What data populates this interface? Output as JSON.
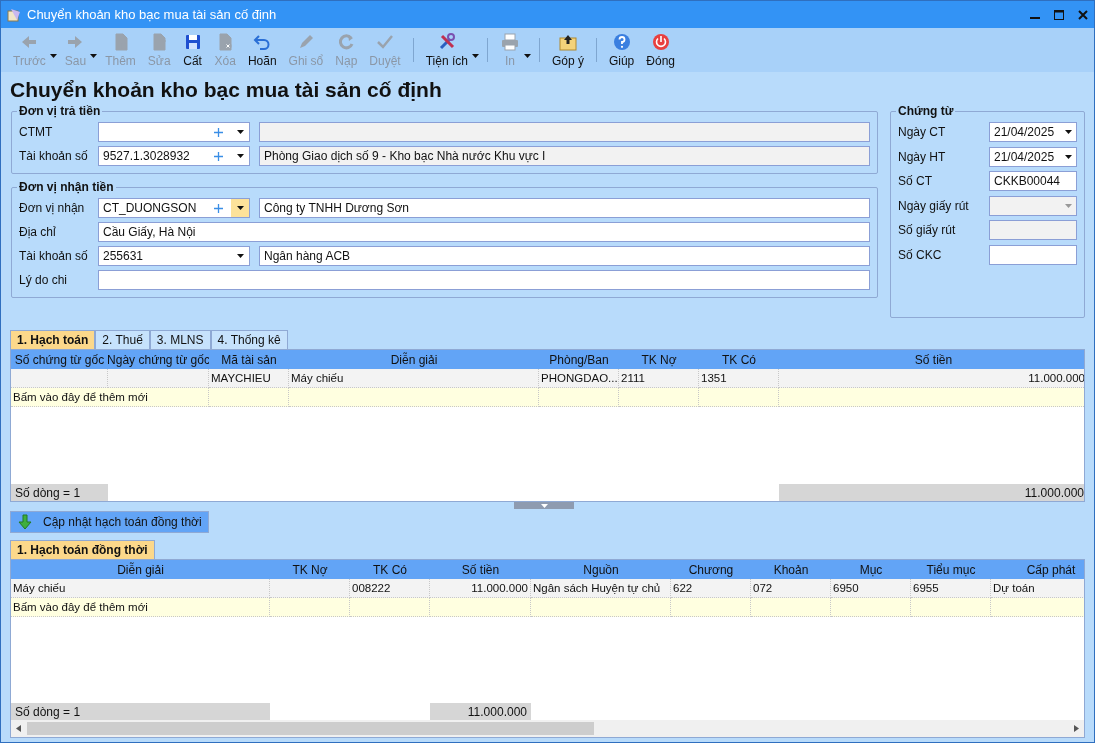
{
  "window": {
    "title": "Chuyển khoản kho bạc mua tài sản cố định"
  },
  "toolbar": [
    [
      {
        "label": "Trước",
        "disabled": true,
        "dropdown": true
      },
      {
        "label": "Sau",
        "disabled": true,
        "dropdown": true
      },
      {
        "label": "Thêm",
        "disabled": true,
        "dropdown": false
      },
      {
        "label": "Sửa",
        "disabled": true,
        "dropdown": false
      },
      {
        "label": "Cất",
        "disabled": false,
        "dropdown": false
      },
      {
        "label": "Xóa",
        "disabled": true,
        "dropdown": false
      },
      {
        "label": "Hoãn",
        "disabled": false,
        "dropdown": false
      },
      {
        "label": "Ghi sổ",
        "disabled": true,
        "dropdown": false
      },
      {
        "label": "Nạp",
        "disabled": true,
        "dropdown": false
      },
      {
        "label": "Duyệt",
        "disabled": true,
        "dropdown": false
      }
    ],
    [
      {
        "label": "Tiện ích",
        "disabled": false,
        "dropdown": true
      }
    ],
    [
      {
        "label": "In",
        "disabled": true,
        "dropdown": true
      }
    ],
    [
      {
        "label": "Góp ý",
        "disabled": false,
        "dropdown": false
      }
    ],
    [
      {
        "label": "Giúp",
        "disabled": false,
        "dropdown": false
      },
      {
        "label": "Đóng",
        "disabled": false,
        "dropdown": false
      }
    ]
  ],
  "heading": "Chuyển khoản kho bạc mua tài sản cố định",
  "payer": {
    "title": "Đơn vị trả tiền",
    "rows": [
      {
        "label": "CTMT",
        "fields": [
          {
            "kind": "combo",
            "plus": true,
            "highlighted": false
          },
          {
            "kind": "text",
            "disabled": true
          }
        ]
      },
      {
        "label": "Tài khoản số",
        "fields": [
          {
            "kind": "combo",
            "value": "9527.1.3028932",
            "plus": true,
            "highlighted": false
          },
          {
            "kind": "text",
            "value": "Phòng Giao dịch số 9 - Kho bạc Nhà nước Khu vực I",
            "disabled": true
          }
        ]
      }
    ]
  },
  "payee": {
    "title": "Đơn vị nhận tiền",
    "rows": [
      {
        "label": "Đơn vị nhận",
        "fields": [
          {
            "kind": "combo",
            "value": "CT_DUONGSON",
            "plus": true,
            "highlighted": true
          },
          {
            "kind": "text",
            "value": "Công ty TNHH Dương Sơn",
            "disabled": false
          }
        ]
      },
      {
        "label": "Địa chỉ",
        "fields": [
          {
            "kind": "text",
            "value": "Cầu Giấy, Hà Nội",
            "disabled": false
          }
        ]
      },
      {
        "label": "Tài khoản số",
        "fields": [
          {
            "kind": "combo",
            "value": "255631",
            "plus": false,
            "highlighted": false
          },
          {
            "kind": "text",
            "value": "Ngân hàng ACB",
            "disabled": false
          }
        ]
      },
      {
        "label": "Lý do chi",
        "fields": [
          {
            "kind": "text",
            "disabled": false
          }
        ]
      }
    ]
  },
  "voucher": {
    "title": "Chứng từ",
    "rows": [
      {
        "label": "Ngày CT",
        "kind": "date",
        "value": "21/04/2025",
        "disabled": false
      },
      {
        "label": "Ngày HT",
        "kind": "date",
        "value": "21/04/2025",
        "disabled": false
      },
      {
        "label": "Số CT",
        "kind": "text",
        "value": "CKKB00044",
        "disabled": false
      },
      {
        "label": "Ngày giấy rút",
        "kind": "date",
        "disabled": true
      },
      {
        "label": "Số giấy rút",
        "kind": "text",
        "disabled": true
      },
      {
        "label": "Số CKC",
        "kind": "text",
        "disabled": false
      }
    ]
  },
  "tabs": [
    {
      "label": "1. Hạch toán",
      "selected": true
    },
    {
      "label": "2. Thuế",
      "selected": false
    },
    {
      "label": "3. MLNS",
      "selected": false
    },
    {
      "label": "4. Thống kê",
      "selected": false
    }
  ],
  "entries_table": {
    "columns": [
      "Số chứng từ gốc",
      "Ngày chứng từ gốc",
      "Mã tài sản",
      "Diễn giải",
      "Phòng/Ban",
      "TK Nợ",
      "TK Có",
      "Số tiền"
    ],
    "rows": [
      [
        null,
        null,
        "MAYCHIEU",
        "Máy chiếu",
        "PHONGDAO...",
        "2111",
        "1351",
        "11.000.000"
      ]
    ],
    "new_row_hint": "Bấm vào đây để thêm mới",
    "footer": {
      "row_count": "Số dòng = 1",
      "total": "11.000.000"
    }
  },
  "update_button": "Cập nhật hạch toán đồng thời",
  "lower_tabs": [
    {
      "label": "1. Hạch toán đồng thời",
      "selected": true
    }
  ],
  "concurrent_table": {
    "columns": [
      "Diễn giải",
      "TK Nợ",
      "TK Có",
      "Số tiền",
      "Nguồn",
      "Chương",
      "Khoản",
      "Mục",
      "Tiểu mục",
      "Cấp phát"
    ],
    "rows": [
      [
        "Máy chiếu",
        null,
        "008222",
        "11.000.000",
        "Ngân sách Huyện tự chủ",
        "622",
        "072",
        "6950",
        "6955",
        "Dự toán"
      ]
    ],
    "new_row_hint": "Bấm vào đây để thêm mới",
    "footer": {
      "row_count": "Số dòng = 1",
      "total": "11.000.000"
    }
  }
}
